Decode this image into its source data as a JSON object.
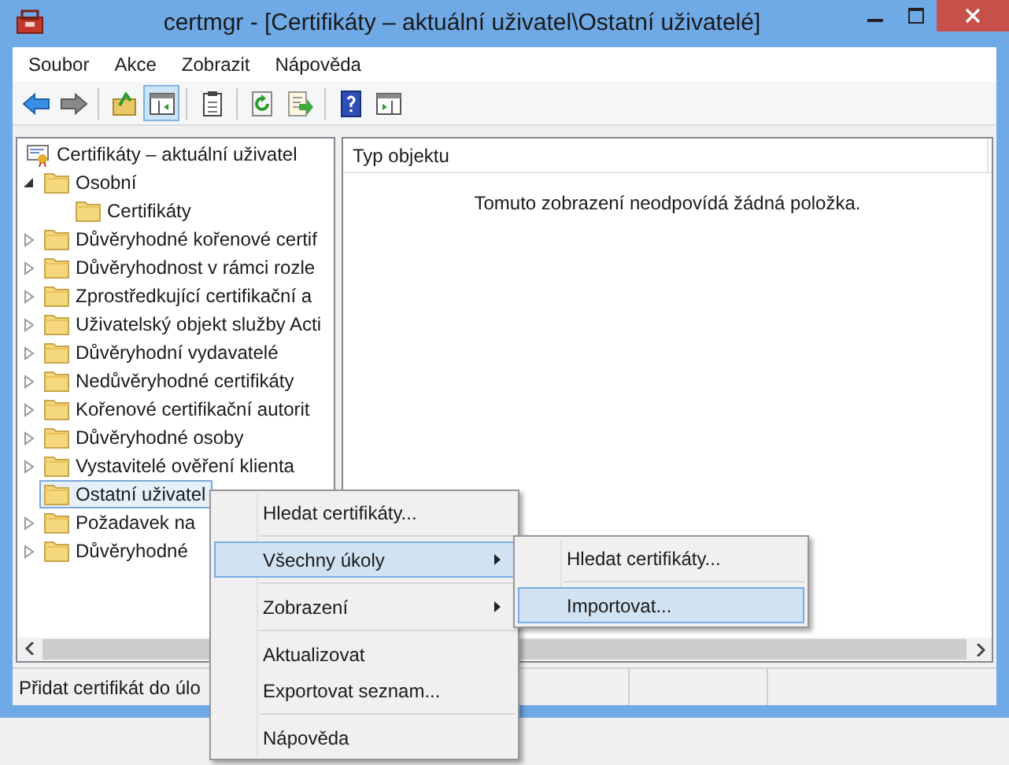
{
  "window": {
    "title": "certmgr - [Certifikáty – aktuální uživatel\\Ostatní uživatelé]"
  },
  "menu_bar": [
    "Soubor",
    "Akce",
    "Zobrazit",
    "Nápověda"
  ],
  "toolbar": [
    {
      "kind": "back",
      "pressed": false
    },
    {
      "kind": "forward",
      "pressed": false
    },
    {
      "kind": "separator"
    },
    {
      "kind": "up",
      "pressed": false
    },
    {
      "kind": "tree",
      "pressed": true
    },
    {
      "kind": "separator"
    },
    {
      "kind": "clipboard",
      "pressed": false
    },
    {
      "kind": "separator"
    },
    {
      "kind": "refresh",
      "pressed": false
    },
    {
      "kind": "export",
      "pressed": false
    },
    {
      "kind": "separator"
    },
    {
      "kind": "help",
      "pressed": false
    },
    {
      "kind": "panel",
      "pressed": false
    }
  ],
  "tree": {
    "label": "Certifikáty – aktuální uživatel",
    "selected": false,
    "children": [
      {
        "label": "Osobní",
        "expanded": true,
        "selected": false,
        "children": [
          {
            "label": "Certifikáty",
            "selected": false
          }
        ]
      },
      {
        "label": "Důvěryhodné kořenové certif",
        "expanded": false,
        "selected": false
      },
      {
        "label": "Důvěryhodnost v rámci rozle",
        "expanded": false,
        "selected": false
      },
      {
        "label": "Zprostředkující certifikační a",
        "expanded": false,
        "selected": false
      },
      {
        "label": "Uživatelský objekt služby Acti",
        "expanded": false,
        "selected": false
      },
      {
        "label": "Důvěryhodní vydavatelé",
        "expanded": false,
        "selected": false
      },
      {
        "label": "Nedůvěryhodné certifikáty",
        "expanded": false,
        "selected": false
      },
      {
        "label": "Kořenové certifikační autorit",
        "expanded": false,
        "selected": false
      },
      {
        "label": "Důvěryhodné osoby",
        "expanded": false,
        "selected": false
      },
      {
        "label": "Vystavitelé ověření klienta",
        "expanded": false,
        "selected": false
      },
      {
        "label": "Ostatní uživatel",
        "selected": true
      },
      {
        "label": "Požadavek na",
        "expanded": false,
        "selected": false
      },
      {
        "label": "Důvěryhodné",
        "expanded": false,
        "selected": false
      }
    ]
  },
  "list_pane": {
    "columns": [
      "Typ objektu"
    ],
    "empty_message": "Tomuto zobrazení neodpovídá žádná položka."
  },
  "status_bar": [
    "Přidat certifikát do úlo"
  ],
  "context_menu": [
    {
      "kind": "item",
      "label": "Hledat certifikáty...",
      "submenu": false,
      "selected": false
    },
    {
      "kind": "separator"
    },
    {
      "kind": "item",
      "label": "Všechny úkoly",
      "submenu": true,
      "selected": true
    },
    {
      "kind": "separator"
    },
    {
      "kind": "item",
      "label": "Zobrazení",
      "submenu": true,
      "selected": false
    },
    {
      "kind": "separator"
    },
    {
      "kind": "item",
      "label": "Aktualizovat",
      "submenu": false,
      "selected": false
    },
    {
      "kind": "item",
      "label": "Exportovat seznam...",
      "submenu": false,
      "selected": false
    },
    {
      "kind": "separator"
    },
    {
      "kind": "item",
      "label": "Nápověda",
      "submenu": false,
      "selected": false
    }
  ],
  "submenu": [
    {
      "kind": "item",
      "label": "Hledat certifikáty...",
      "selected": false
    },
    {
      "kind": "separator"
    },
    {
      "kind": "item",
      "label": "Importovat...",
      "selected": true
    }
  ]
}
